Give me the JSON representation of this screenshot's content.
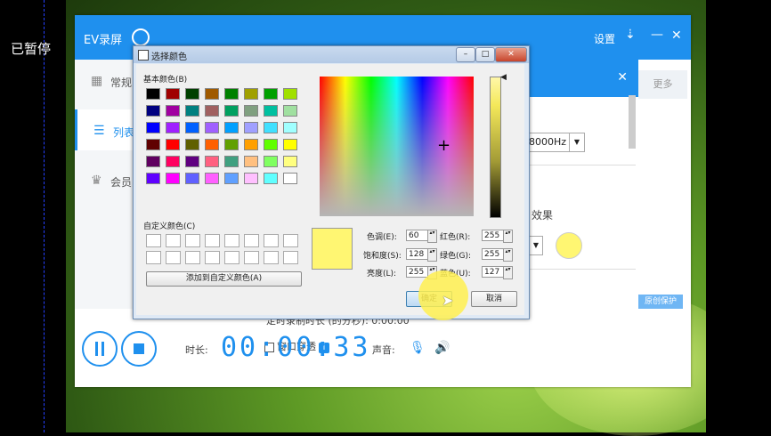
{
  "overlay": {
    "paused_label": "已暂停"
  },
  "app": {
    "title": "EV录屏",
    "settings_label": "设置",
    "menu_glyph": "⇣",
    "min_glyph": "—",
    "close_glyph": "✕"
  },
  "sidebar": {
    "items": [
      {
        "label": "常规",
        "icon": "grid-icon"
      },
      {
        "label": "列表",
        "icon": "list-icon"
      },
      {
        "label": "会员",
        "icon": "crown-icon"
      }
    ]
  },
  "settings_panel": {
    "close_glyph": "✕",
    "more_label": "更多",
    "sample_rate_value": "8000Hz",
    "effect_label": "效果",
    "origin_protect_label": "原创保护",
    "max_time_label": "定时录制时长 (的分秒):",
    "max_time_value": "0:00:00",
    "transparent_label": "窗口穿透",
    "info_glyph": "i"
  },
  "bottom": {
    "time_label": "时长:",
    "timer": "00:00:33",
    "volume_label": "声音:"
  },
  "dialog": {
    "title": "选择颜色",
    "basic_label": "基本颜色(B)",
    "custom_label": "自定义颜色(C)",
    "add_label": "添加到自定义颜色(A)",
    "ok_label": "确定",
    "cancel_label": "取消",
    "basic_colors": [
      "#000000",
      "#a00000",
      "#004000",
      "#a05a00",
      "#008000",
      "#a0a000",
      "#00a000",
      "#a0e000",
      "#000080",
      "#a000a0",
      "#008080",
      "#a06060",
      "#00a060",
      "#80a080",
      "#00c0a0",
      "#a0e0a0",
      "#0000ff",
      "#a020ff",
      "#0060ff",
      "#a060ff",
      "#00a0ff",
      "#a0a0ff",
      "#40e0ff",
      "#a0ffff",
      "#600000",
      "#ff0000",
      "#606000",
      "#ff6000",
      "#60a000",
      "#ffa000",
      "#60ff00",
      "#ffff00",
      "#600060",
      "#ff0060",
      "#600080",
      "#ff6080",
      "#40a080",
      "#ffc080",
      "#80ff60",
      "#ffff80",
      "#6000ff",
      "#ff00ff",
      "#6060ff",
      "#ff60ff",
      "#60a0ff",
      "#ffc0ff",
      "#60ffff",
      "#ffffff"
    ],
    "fields": {
      "hue_label": "色调(E):",
      "hue": "60",
      "sat_label": "饱和度(S):",
      "sat": "128",
      "lum_label": "亮度(L):",
      "lum": "255",
      "red_label": "红色(R):",
      "red": "255",
      "green_label": "绿色(G):",
      "green": "255",
      "blue_label": "蓝色(U):",
      "blue": "127"
    },
    "selected_color": "#fff672"
  }
}
